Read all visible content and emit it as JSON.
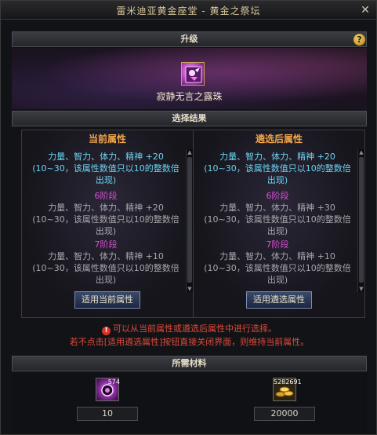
{
  "window": {
    "title": "雷米迪亚黄金座堂 - 黄金之祭坛",
    "close_icon": "close-icon"
  },
  "upgrade": {
    "header": "升级",
    "help_icon": "help-icon",
    "help_glyph": "?",
    "item_name": "寂静无言之露珠"
  },
  "results": {
    "header": "选择结果"
  },
  "panels": {
    "current": {
      "title": "当前属性",
      "attr1": "力量、智力、体力、精神 +20 (10~30，该属性数值只以10的整数倍出现)",
      "stage6_label": "6阶段",
      "stage6_text": "力量、智力、体力、精神 +20 (10~30，该属性数值只以10的整数倍出现)",
      "stage7_label": "7阶段",
      "stage7_text": "力量、智力、体力、精神 +10 (10~30，该属性数值只以10的整数倍出现)",
      "button": "适用当前属性"
    },
    "selected": {
      "title": "遴选后属性",
      "attr1": "力量、智力、体力、精神 +20 (10~30，该属性数值只以10的整数倍出现)",
      "stage6_label": "6阶段",
      "stage6_text": "力量、智力、体力、精神 +30 (10~30，该属性数值只以10的整数倍出现)",
      "stage7_label": "7阶段",
      "stage7_text": "力量、智力、体力、精神 +10 (10~30，该属性数值只以10的整数倍出现)",
      "button": "适用遴选属性"
    }
  },
  "notice": {
    "warn_glyph": "!",
    "line1": "可以从当前属性或遴选后属性中进行选择。",
    "line2": "若不点击[适用遴选属性]按钮直接关闭界面，则维持当前属性。"
  },
  "materials": {
    "header": "所需材料",
    "item1": {
      "stack": "574",
      "required": "10"
    },
    "item2": {
      "stack": "5282691",
      "required": "20000"
    }
  },
  "colors": {
    "accent": "#f2a546",
    "stage": "#d84fd4",
    "attr": "#6ad4f2",
    "warn": "#e14a3c"
  }
}
